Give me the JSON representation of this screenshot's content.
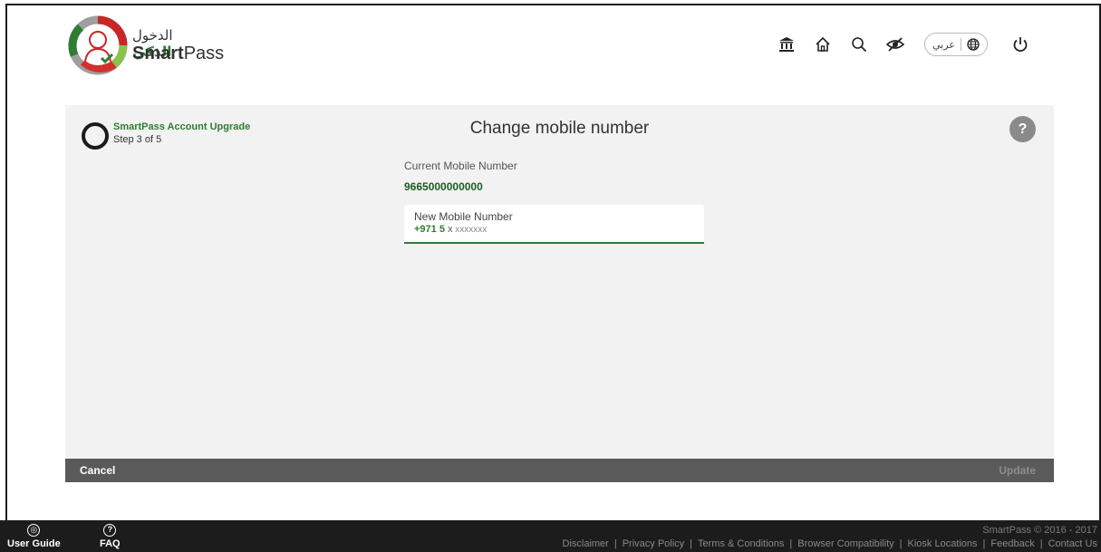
{
  "header": {
    "logo_ar_light": "الدخول",
    "logo_ar_bold": "الذكي",
    "logo_en_bold": "Smart",
    "logo_en_light": "Pass",
    "icons": [
      "government-icon",
      "home-icon",
      "search-icon",
      "accessibility-eye-icon",
      "globe-icon",
      "power-icon"
    ],
    "language_label": "عربي"
  },
  "step": {
    "title": "SmartPass Account Upgrade",
    "subtitle": "Step 3 of 5"
  },
  "page": {
    "title": "Change mobile number",
    "help": "?"
  },
  "form": {
    "current_label": "Current Mobile Number",
    "current_value": "9665000000000",
    "new_label": "New Mobile Number",
    "prefix": "+971 5",
    "placeholder_digit": "x",
    "placeholder_rest": "xxxxxxx"
  },
  "actions": {
    "cancel": "Cancel",
    "update": "Update"
  },
  "footer": {
    "user_guide": "User Guide",
    "faq": "FAQ",
    "copyright": "SmartPass © 2016 - 2017",
    "links": [
      "Disclaimer",
      "Privacy Policy",
      "Terms & Conditions",
      "Browser Compatibility",
      "Kiosk Locations",
      "Feedback",
      "Contact Us"
    ]
  },
  "colors": {
    "brand_green": "#2e7d32",
    "dark_green": "#1b5e20",
    "action_bar": "#5a5a5a",
    "footer_bg": "#1c1c1c"
  }
}
